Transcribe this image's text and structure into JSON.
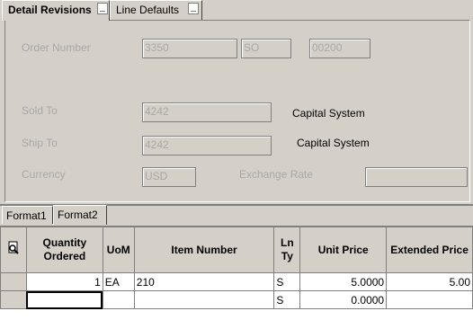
{
  "tabs": {
    "detail_revisions": "Detail Revisions",
    "line_defaults": "Line Defaults"
  },
  "header": {
    "order_number_label": "Order Number",
    "order_number": "3350",
    "order_type": "SO",
    "order_company": "00200",
    "sold_to_label": "Sold To",
    "sold_to": "4242",
    "sold_to_name": "Capital System",
    "ship_to_label": "Ship To",
    "ship_to": "4242",
    "ship_to_name": "Capital System",
    "currency_label": "Currency",
    "currency": "USD",
    "exchange_rate_label": "Exchange Rate",
    "exchange_rate": ""
  },
  "format_tabs": {
    "format1": "Format1",
    "format2": "Format2"
  },
  "grid": {
    "columns": {
      "qty": "Quantity Ordered",
      "uom": "UoM",
      "item": "Item Number",
      "ln_ty": "Ln Ty",
      "unit_price": "Unit Price",
      "ext_price": "Extended Price"
    },
    "rows": [
      {
        "qty": "1",
        "uom": "EA",
        "item": "210",
        "ln_ty": "S",
        "unit_price": "5.0000",
        "ext_price": "5.00"
      },
      {
        "qty": "",
        "uom": "",
        "item": "",
        "ln_ty": "S",
        "unit_price": "0.0000",
        "ext_price": ""
      }
    ]
  }
}
